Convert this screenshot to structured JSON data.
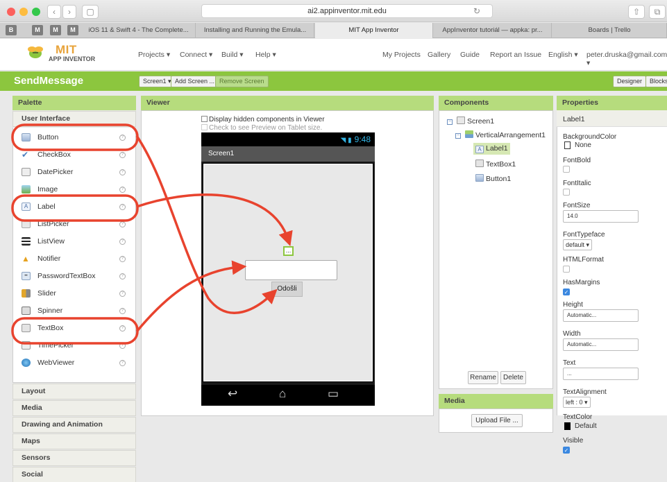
{
  "browser": {
    "url": "ai2.appinventor.mit.edu",
    "tabs": [
      "iOS 11 & Swift 4 - The Complete...",
      "Installing and Running the Emula...",
      "MIT App Inventor",
      "AppInventor tutoriál — appka: pr...",
      "Boards | Trello"
    ],
    "pinned": [
      "B",
      "M",
      "M",
      "M"
    ]
  },
  "header": {
    "logo_main": "MIT",
    "logo_sub": "APP INVENTOR",
    "menu": [
      "Projects ▾",
      "Connect ▾",
      "Build ▾",
      "Help ▾"
    ],
    "right_links": [
      "My Projects",
      "Gallery",
      "Guide",
      "Report an Issue",
      "English ▾",
      "peter.druska@gmail.com ▾"
    ]
  },
  "toolbar": {
    "project_name": "SendMessage",
    "screen_select": "Screen1 ▾",
    "add_screen": "Add Screen ...",
    "remove_screen": "Remove Screen",
    "designer": "Designer",
    "blocks": "Blocks"
  },
  "palette": {
    "title": "Palette",
    "section": "User Interface",
    "items": [
      {
        "label": "Button",
        "icon": "button-icon"
      },
      {
        "label": "CheckBox",
        "icon": "checkbox-icon"
      },
      {
        "label": "DatePicker",
        "icon": "datepicker-icon"
      },
      {
        "label": "Image",
        "icon": "image-icon"
      },
      {
        "label": "Label",
        "icon": "label-icon"
      },
      {
        "label": "ListPicker",
        "icon": "listpicker-icon"
      },
      {
        "label": "ListView",
        "icon": "listview-icon"
      },
      {
        "label": "Notifier",
        "icon": "notifier-icon"
      },
      {
        "label": "PasswordTextBox",
        "icon": "password-icon"
      },
      {
        "label": "Slider",
        "icon": "slider-icon"
      },
      {
        "label": "Spinner",
        "icon": "spinner-icon"
      },
      {
        "label": "TextBox",
        "icon": "textbox-icon"
      },
      {
        "label": "TimePicker",
        "icon": "timepicker-icon"
      },
      {
        "label": "WebViewer",
        "icon": "webviewer-icon"
      }
    ],
    "help": "?",
    "categories": [
      "Layout",
      "Media",
      "Drawing and Animation",
      "Maps",
      "Sensors",
      "Social"
    ]
  },
  "viewer": {
    "title": "Viewer",
    "hidden_components": "Display hidden components in Viewer",
    "tablet_preview": "Check to see Preview on Tablet size.",
    "status_time": "9:48",
    "screen_title": "Screen1",
    "label_text": "...",
    "button_text": "Odošli"
  },
  "components": {
    "title": "Components",
    "tree": [
      "Screen1",
      "VerticalArrangement1",
      "Label1",
      "TextBox1",
      "Button1"
    ],
    "rename": "Rename",
    "delete": "Delete"
  },
  "media": {
    "title": "Media",
    "upload": "Upload File ..."
  },
  "properties": {
    "title": "Properties",
    "component": "Label1",
    "background_color_label": "BackgroundColor",
    "background_color_value": "None",
    "font_bold": "FontBold",
    "font_italic": "FontItalic",
    "font_size": "FontSize",
    "font_size_value": "14.0",
    "font_typeface": "FontTypeface",
    "font_typeface_value": "default ▾",
    "html_format": "HTMLFormat",
    "has_margins": "HasMargins",
    "height": "Height",
    "height_value": "Automatic...",
    "width": "Width",
    "width_value": "Automatic...",
    "text": "Text",
    "text_value": "...",
    "text_alignment": "TextAlignment",
    "text_alignment_value": "left : 0 ▾",
    "text_color": "TextColor",
    "text_color_value": "Default",
    "visible": "Visible"
  }
}
